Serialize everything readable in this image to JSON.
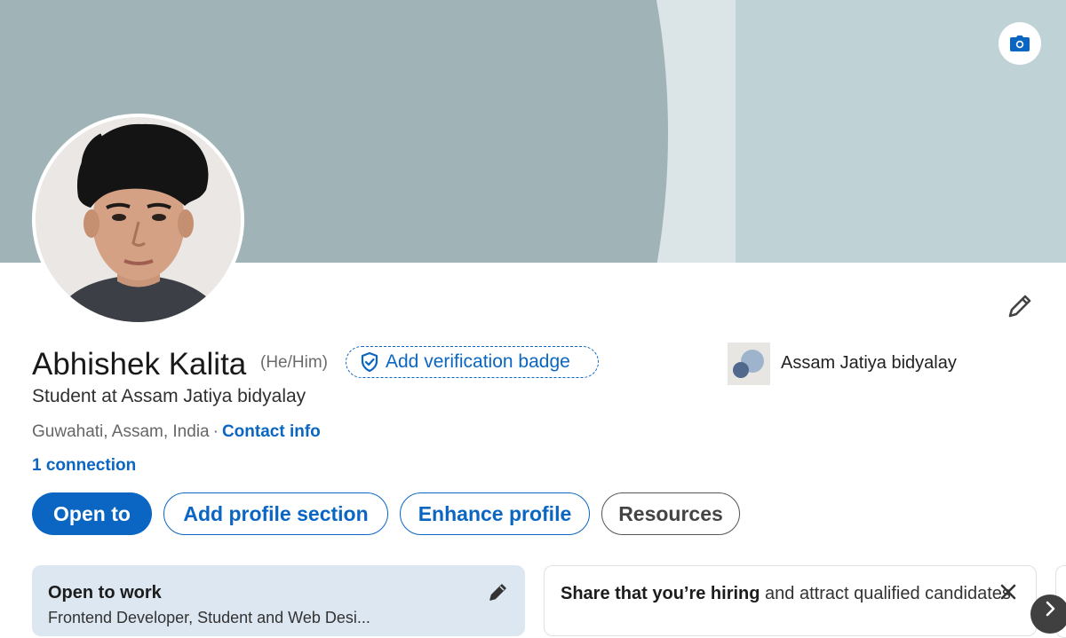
{
  "profile": {
    "name": "Abhishek Kalita",
    "pronouns": "(He/Him)",
    "verification_label": "Add verification badge",
    "headline": "Student at Assam Jatiya bidyalay",
    "location": "Guwahati, Assam, India",
    "separator": "·",
    "contact_label": "Contact info",
    "connections": "1 connection"
  },
  "education": {
    "name": "Assam Jatiya bidyalay"
  },
  "actions": {
    "open_to": "Open to",
    "add_section": "Add profile section",
    "enhance": "Enhance profile",
    "resources": "Resources"
  },
  "cards": {
    "open_to_work": {
      "title": "Open to work",
      "roles": "Frontend Developer, Student and Web Desi..."
    },
    "hiring": {
      "bold": "Share that you’re hiring",
      "rest": " and attract qualified candidates"
    }
  },
  "colors": {
    "accent": "#0a66c2",
    "banner_dark": "#a0b3b7",
    "banner_light": "#bfd2d6",
    "open_to_work_bg": "#dde7f1"
  },
  "icons": {
    "banner_camera": "camera-icon",
    "edit_intro": "pencil-icon",
    "verification": "shield-check-icon",
    "close": "close-icon",
    "next": "chevron-right-icon"
  }
}
